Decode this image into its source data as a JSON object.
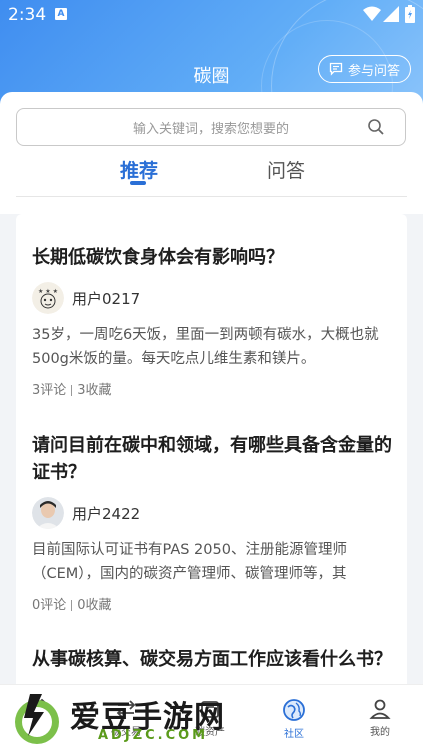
{
  "status_bar": {
    "time": "2:34"
  },
  "header": {
    "title": "碳圈",
    "ask_button_label": "参与问答"
  },
  "search": {
    "placeholder": "输入关键词，搜索您想要的"
  },
  "tabs": [
    {
      "label": "推荐",
      "active": true
    },
    {
      "label": "问答",
      "active": false
    }
  ],
  "posts": [
    {
      "question": "长期低碳饮食身体会有影响吗？",
      "user": "用户0217",
      "body": "35岁，一周吃6天饭，里面一到两顿有碳水，大概也就500g米饭的量。每天吃点儿维生素和镁片。",
      "comments": "3评论",
      "favorites": "3收藏"
    },
    {
      "question": "请问目前在碳中和领域，有哪些具备含金量的证书？",
      "user": "用户2422",
      "body": "目前国际认可证书有PAS 2050、注册能源管理师（CEM），国内的碳资产管理师、碳管理师等，其",
      "comments": "0评论",
      "favorites": "0收藏"
    },
    {
      "question": "从事碳核算、碳交易方面工作应该看什么书？"
    }
  ],
  "bottom_nav": [
    {
      "label": "首页",
      "icon": "home-icon"
    },
    {
      "label": "碳交易",
      "icon": "trade-icon"
    },
    {
      "label": "碳资产",
      "icon": "asset-icon"
    },
    {
      "label": "社区",
      "icon": "community-icon",
      "active": true
    },
    {
      "label": "我的",
      "icon": "user-icon"
    }
  ],
  "watermark": {
    "text": "爱豆手游网",
    "sub": "ADJZC.COM"
  },
  "colors": {
    "accent": "#2a6fd6",
    "header_start": "#3f8df0",
    "watermark_green": "#5a9a1a"
  }
}
